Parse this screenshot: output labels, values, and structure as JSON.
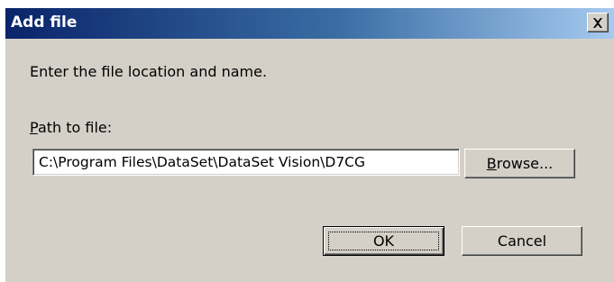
{
  "window": {
    "title": "Add file",
    "close_icon": "close-icon"
  },
  "dialog": {
    "instruction": "Enter the file location and name.",
    "path_label_accel": "P",
    "path_label_rest": "ath to file:",
    "path_value": "C:\\Program Files\\DataSet\\DataSet Vision\\D7CG",
    "browse_accel": "B",
    "browse_rest": "rowse...",
    "ok_label": "OK",
    "cancel_label": "Cancel"
  },
  "colors": {
    "dialog_bg": "#d4d0c8",
    "titlebar_start": "#0a246a",
    "titlebar_end": "#a6caf0"
  }
}
